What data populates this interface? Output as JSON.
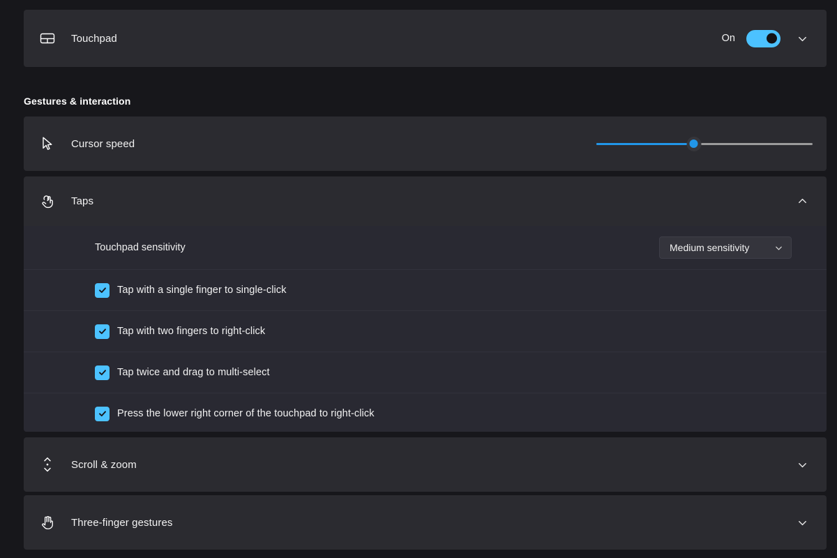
{
  "header": {
    "icon": "touchpad-icon",
    "title": "Touchpad",
    "toggle_state_label": "On",
    "toggle_on": true,
    "expand_icon": "chevron-down-icon"
  },
  "section": {
    "caption": "Gestures & interaction"
  },
  "cursor_speed": {
    "icon": "cursor-arrow-icon",
    "label": "Cursor speed",
    "slider_value_percent": 45
  },
  "taps": {
    "icon": "tap-gesture-icon",
    "label": "Taps",
    "expanded": true,
    "collapse_icon": "chevron-up-icon",
    "sensitivity": {
      "label": "Touchpad sensitivity",
      "selected": "Medium sensitivity",
      "chevron_icon": "chevron-down-icon"
    },
    "checkboxes": [
      {
        "label": "Tap with a single finger to single-click",
        "checked": true
      },
      {
        "label": "Tap with two fingers to right-click",
        "checked": true
      },
      {
        "label": "Tap twice and drag to multi-select",
        "checked": true
      },
      {
        "label": "Press the lower right corner of the touchpad to right-click",
        "checked": true
      }
    ]
  },
  "scroll_zoom": {
    "icon": "scroll-vertical-icon",
    "label": "Scroll & zoom",
    "expand_icon": "chevron-down-icon"
  },
  "three_finger": {
    "icon": "three-finger-hand-icon",
    "label": "Three-finger gestures",
    "expand_icon": "chevron-down-icon"
  },
  "colors": {
    "page_background": "#17171b",
    "card_background": "#2b2b30",
    "subpanel_background": "#292932",
    "accent": "#4cc2ff",
    "slider_accent": "#2196e8",
    "text_primary": "#f2f2f2"
  }
}
